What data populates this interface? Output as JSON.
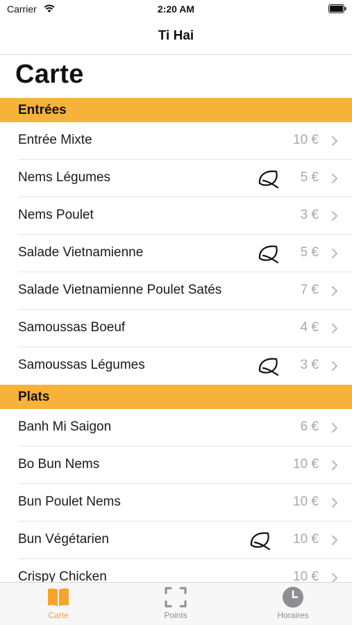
{
  "status_bar": {
    "carrier": "Carrier",
    "time": "2:20 AM"
  },
  "nav": {
    "title": "Ti Hai"
  },
  "page": {
    "title": "Carte"
  },
  "colors": {
    "accent": "#f6b23a",
    "price": "#a8a8ad",
    "tab_active": "#f6a32a",
    "tab_inactive": "#8e8e93"
  },
  "sections": [
    {
      "title": "Entrées",
      "items": [
        {
          "name": "Entrée Mixte",
          "price": "10 €",
          "vegetarian": false
        },
        {
          "name": "Nems Légumes",
          "price": "5 €",
          "vegetarian": true
        },
        {
          "name": "Nems Poulet",
          "price": "3 €",
          "vegetarian": false
        },
        {
          "name": "Salade Vietnamienne",
          "price": "5 €",
          "vegetarian": true
        },
        {
          "name": "Salade Vietnamienne Poulet Satés",
          "price": "7 €",
          "vegetarian": false
        },
        {
          "name": "Samoussas Boeuf",
          "price": "4 €",
          "vegetarian": false
        },
        {
          "name": "Samoussas Légumes",
          "price": "3 €",
          "vegetarian": true
        }
      ]
    },
    {
      "title": "Plats",
      "items": [
        {
          "name": "Banh Mi Saigon",
          "price": "6 €",
          "vegetarian": false
        },
        {
          "name": "Bo Bun Nems",
          "price": "10 €",
          "vegetarian": false
        },
        {
          "name": "Bun Poulet Nems",
          "price": "10 €",
          "vegetarian": false
        },
        {
          "name": "Bun Végétarien",
          "price": "10 €",
          "vegetarian": true
        },
        {
          "name": "Crispy Chicken",
          "price": "10 €",
          "vegetarian": false
        }
      ]
    }
  ],
  "tabs": [
    {
      "label": "Carte",
      "icon": "book-icon",
      "active": true
    },
    {
      "label": "Points",
      "icon": "scan-frame-icon",
      "active": false
    },
    {
      "label": "Horaires",
      "icon": "clock-icon",
      "active": false
    }
  ]
}
